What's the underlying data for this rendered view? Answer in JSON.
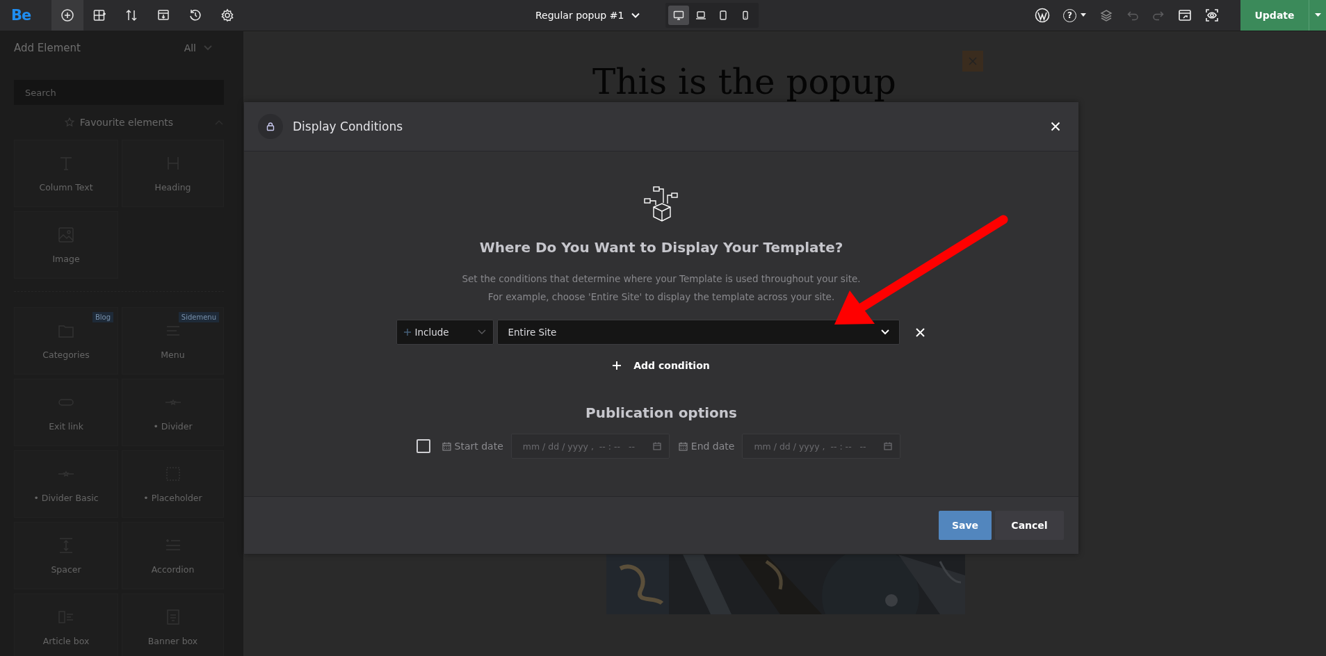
{
  "topbar": {
    "logo": "Be",
    "tools": [
      {
        "selected": true
      },
      {
        "selected": false
      },
      {
        "selected": false
      },
      {
        "selected": false
      },
      {
        "selected": false
      },
      {
        "selected": false
      }
    ],
    "document_title": "Regular popup #1",
    "devices": [
      {
        "selected": true
      },
      {
        "selected": false
      },
      {
        "selected": false
      },
      {
        "selected": false
      }
    ],
    "help": "?",
    "history": [
      {
        "disabled": true
      },
      {
        "disabled": true
      }
    ],
    "update_button": "Update"
  },
  "sidebar": {
    "title": "Add Element",
    "filter": "All",
    "search_placeholder": "Search",
    "favourites_title": "Favourite elements",
    "favourites": [
      {
        "label": "Column Text"
      },
      {
        "label": "Heading"
      },
      {
        "label": "Image"
      }
    ],
    "elements": [
      {
        "label": "Categories",
        "badge": "Blog"
      },
      {
        "label": "Menu",
        "badge": "Sidemenu"
      },
      {
        "label": "Exit link"
      },
      {
        "label": "• Divider"
      },
      {
        "label": "• Divider Basic"
      },
      {
        "label": "• Placeholder"
      },
      {
        "label": "Spacer"
      },
      {
        "label": "Accordion"
      },
      {
        "label": "Article box"
      },
      {
        "label": "Banner box"
      }
    ]
  },
  "canvas": {
    "popup_heading": "This is the popup"
  },
  "modal": {
    "title": "Display Conditions",
    "heading": "Where Do You Want to Display Your Template?",
    "description": [
      "Set the conditions that determine where your Template is used throughout your site.",
      "For example, choose 'Entire Site' to display the template across your site."
    ],
    "condition": {
      "mode": "Include",
      "target": "Entire Site"
    },
    "add_condition": "Add condition",
    "publication": {
      "title": "Publication options",
      "enabled": false,
      "start_label": "Start date",
      "end_label": "End date",
      "start_placeholder": "mm / dd / yyyy ,  -- : --   --",
      "end_placeholder": "mm / dd / yyyy ,  -- : --   --"
    },
    "save_button": "Save",
    "cancel_button": "Cancel"
  }
}
